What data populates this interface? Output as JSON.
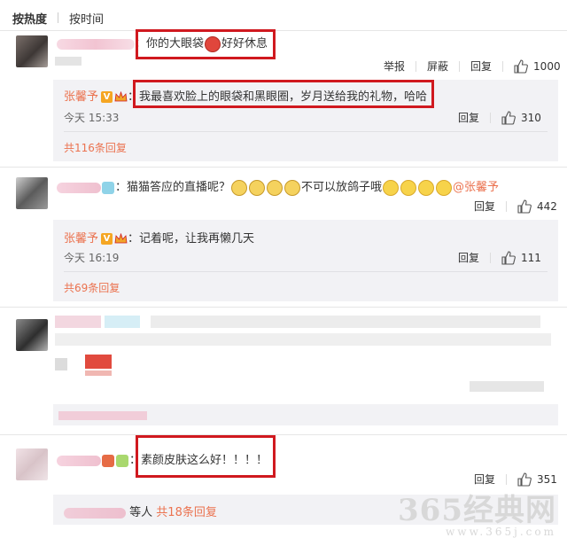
{
  "tabs": [
    {
      "label": "按热度",
      "active": true
    },
    {
      "label": "按时间",
      "active": false
    }
  ],
  "comments": [
    {
      "text_prefix": "：你的大眼袋",
      "text_suffix": "好好休息",
      "emoji": "angry-face-icon",
      "actions": {
        "report": "举报",
        "block": "屏蔽",
        "reply": "回复",
        "likes": "1000"
      },
      "reply": {
        "author": "张馨予",
        "text": "：我最喜欢脸上的眼袋和黑眼圈，岁月送给我的礼物，哈哈",
        "time": "今天 15:33",
        "reply_label": "回复",
        "likes": "310"
      },
      "more_replies": "共116条回复"
    },
    {
      "text_prefix": "：猫猫答应的直播呢？",
      "text_middle": "不可以放鸽子哦",
      "mention": "@张馨予",
      "actions": {
        "reply": "回复",
        "likes": "442"
      },
      "reply": {
        "author": "张馨予",
        "text": "：记着呢，让我再懒几天",
        "time": "今天 16:19",
        "reply_label": "回复",
        "likes": "111"
      },
      "more_replies": "共69条回复"
    },
    {
      "text": "：素颜皮肤这么好！！！！",
      "actions": {
        "reply": "回复",
        "likes": "351"
      },
      "more_replies_prefix": "等人",
      "more_replies": "共18条回复"
    }
  ],
  "watermark": {
    "big": "365经典网",
    "small": "www.365j.com"
  },
  "colors": {
    "accent": "#eb7350",
    "highlight": "#d0191f",
    "reply_bg": "#f2f2f5"
  }
}
